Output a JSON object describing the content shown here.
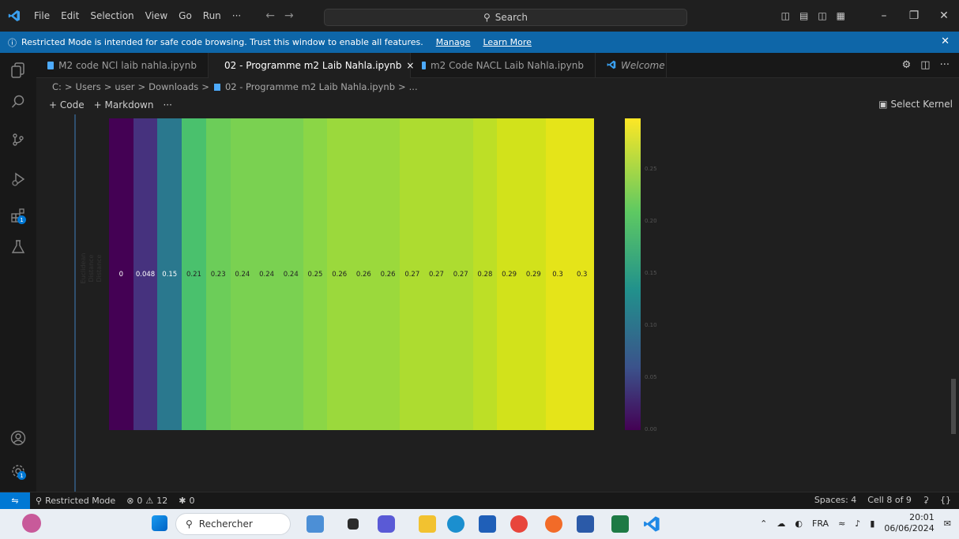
{
  "titlebar": {
    "menu": [
      "File",
      "Edit",
      "Selection",
      "View",
      "Go",
      "Run",
      "···"
    ],
    "search_placeholder": "Search"
  },
  "banner": {
    "message": "Restricted Mode is intended for safe code browsing. Trust this window to enable all features.",
    "manage": "Manage",
    "learn_more": "Learn More"
  },
  "tabs": [
    {
      "label": "M2 code NCl laib nahla.ipynb"
    },
    {
      "label": "02 - Programme m2 Laib Nahla.ipynb",
      "close": "×"
    },
    {
      "label": "m2 Code NACL Laib Nahla.ipynb"
    },
    {
      "label": "Welcome"
    }
  ],
  "breadcrumb": {
    "parts": [
      "C:",
      "Users",
      "user",
      "Downloads",
      "02 - Programme m2 Laib Nahla.ipynb",
      "..."
    ],
    "sep": ">"
  },
  "toolbar": {
    "code": "Code",
    "markdown": "Markdown",
    "more": "···",
    "select_kernel": "Select Kernel"
  },
  "chart_data": {
    "type": "heatmap",
    "ylabel": "Euclidean Distance Distance",
    "values": [
      0,
      0.048,
      0.15,
      0.21,
      0.23,
      0.24,
      0.24,
      0.24,
      0.25,
      0.26,
      0.26,
      0.26,
      0.27,
      0.27,
      0.27,
      0.28,
      0.29,
      0.29,
      0.3,
      0.3
    ],
    "labels": [
      "0",
      "0.048",
      "0.15",
      "0.21",
      "0.23",
      "0.24",
      "0.24",
      "0.24",
      "0.25",
      "0.26",
      "0.26",
      "0.26",
      "0.27",
      "0.27",
      "0.27",
      "0.28",
      "0.29",
      "0.29",
      "0.3",
      "0.3"
    ],
    "colors": [
      "#440154",
      "#46327e",
      "#2a788e",
      "#4ac16d",
      "#6ccd59",
      "#7ad151",
      "#7ad151",
      "#7ad151",
      "#8bd646",
      "#9bd93c",
      "#9bd93c",
      "#9bd93c",
      "#addc30",
      "#addc30",
      "#addc30",
      "#bddf26",
      "#d2e21b",
      "#d2e21b",
      "#e5e419",
      "#e5e419"
    ],
    "colorbar_ticks": [
      "0.25",
      "0.20",
      "0.15",
      "0.10",
      "0.05",
      "0.00"
    ],
    "colormap": "viridis"
  },
  "status": {
    "restricted": "Restricted Mode",
    "errors": "0",
    "warnings": "12",
    "ports": "0",
    "spaces": "Spaces: 4",
    "cell": "Cell 8 of 9"
  },
  "taskbar": {
    "search": "Rechercher",
    "lang": "FRA",
    "time": "20:01",
    "date": "06/06/2024"
  }
}
